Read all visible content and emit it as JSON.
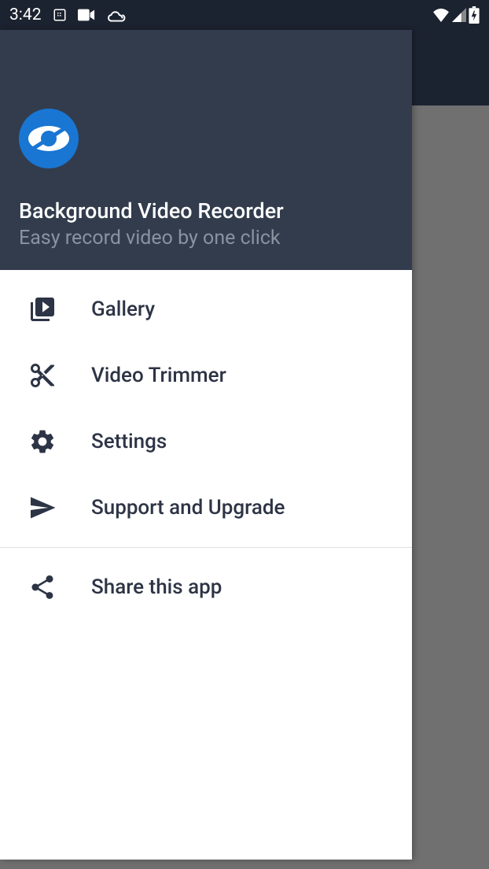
{
  "status": {
    "time": "3:42"
  },
  "app": {
    "title": "Background Video Recorder",
    "subtitle": "Easy record video by one click"
  },
  "menu": {
    "items": [
      {
        "label": "Gallery"
      },
      {
        "label": "Video Trimmer"
      },
      {
        "label": "Settings"
      },
      {
        "label": "Support and Upgrade"
      }
    ],
    "share": {
      "label": "Share this app"
    }
  }
}
